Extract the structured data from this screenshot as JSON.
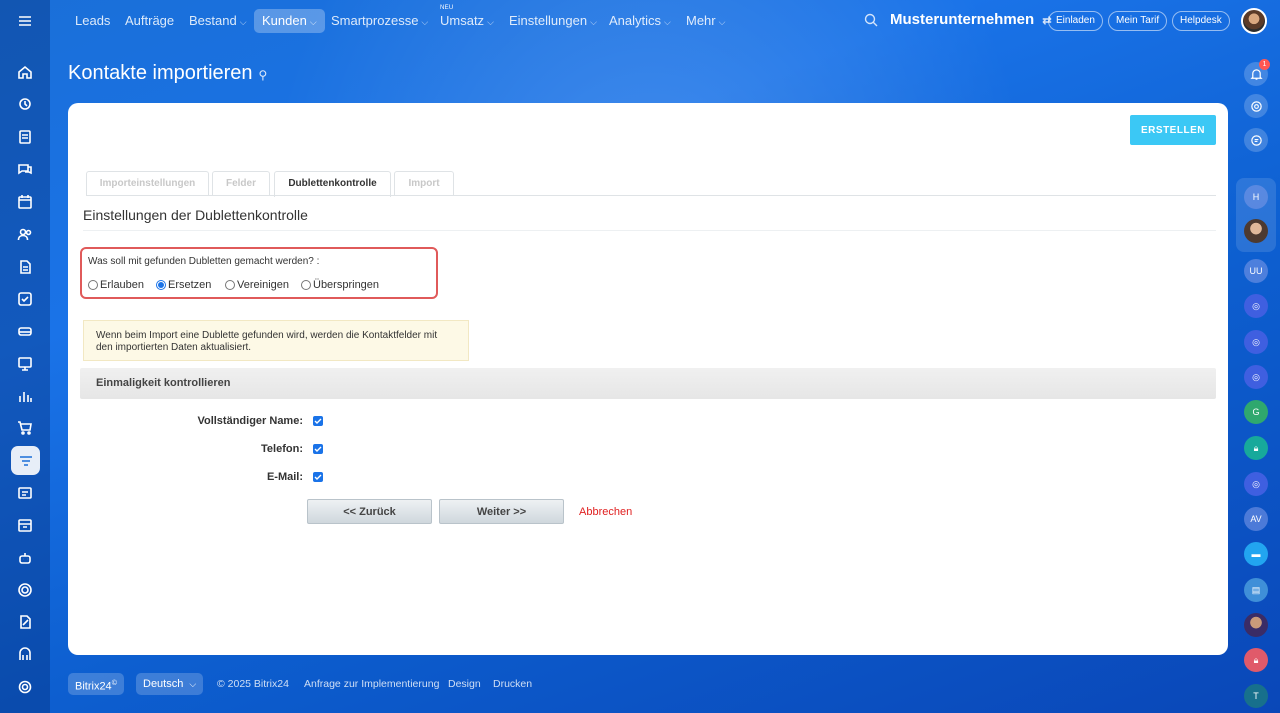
{
  "topnav": {
    "items": [
      {
        "label": "Leads",
        "chevron": false
      },
      {
        "label": "Aufträge",
        "chevron": false
      },
      {
        "label": "Bestand",
        "chevron": true
      },
      {
        "label": "Kunden",
        "chevron": true
      },
      {
        "label": "Smartprozesse",
        "chevron": true
      },
      {
        "label": "Umsatz",
        "chevron": true
      },
      {
        "label": "Einstellungen",
        "chevron": true
      },
      {
        "label": "Analytics",
        "chevron": true
      },
      {
        "label": "Mehr",
        "chevron": true
      }
    ],
    "active": "Kunden",
    "new_badge": "NEU",
    "company": "Musterunternehmen",
    "invite": "Einladen",
    "plan": "Mein Tarif",
    "helpdesk": "Helpdesk"
  },
  "notifications": {
    "count": "1"
  },
  "right_bar": {
    "avatars": [
      "H",
      "UU",
      "G",
      "AV",
      "T"
    ]
  },
  "page": {
    "title": "Kontakte importieren"
  },
  "card": {
    "create_button": "ERSTELLEN",
    "tabs": [
      "Importeinstellungen",
      "Felder",
      "Dublettenkontrolle",
      "Import"
    ],
    "active_tab": "Dublettenkontrolle",
    "section_title": "Einstellungen der Dublettenkontrolle",
    "question": "Was soll mit gefunden Dubletten gemacht werden? :",
    "options": [
      "Erlauben",
      "Ersetzen",
      "Vereinigen",
      "Überspringen"
    ],
    "selected_option": "Ersetzen",
    "note": "Wenn beim Import eine Dublette gefunden wird, werden die Kontaktfelder mit den importierten Daten aktualisiert.",
    "uniqueness_title": "Einmaligkeit kontrollieren",
    "fields": [
      {
        "label": "Vollständiger Name:",
        "checked": true
      },
      {
        "label": "Telefon:",
        "checked": true
      },
      {
        "label": "E-Mail:",
        "checked": true
      }
    ],
    "back_button": "<< Zurück",
    "next_button": "Weiter >>",
    "cancel_link": "Abbrechen"
  },
  "footer": {
    "brand": "Bitrix24",
    "brand_mark": "©",
    "language": "Deutsch",
    "copyright": "© 2025 Bitrix24",
    "links": [
      "Anfrage zur Implementierung",
      "Design",
      "Drucken"
    ]
  },
  "colors": {
    "accent": "#1a73e8",
    "create_button": "#3bc8f5",
    "highlight_border": "#e05a5a",
    "cancel": "#e02020",
    "note_bg": "#fdf9e6"
  }
}
